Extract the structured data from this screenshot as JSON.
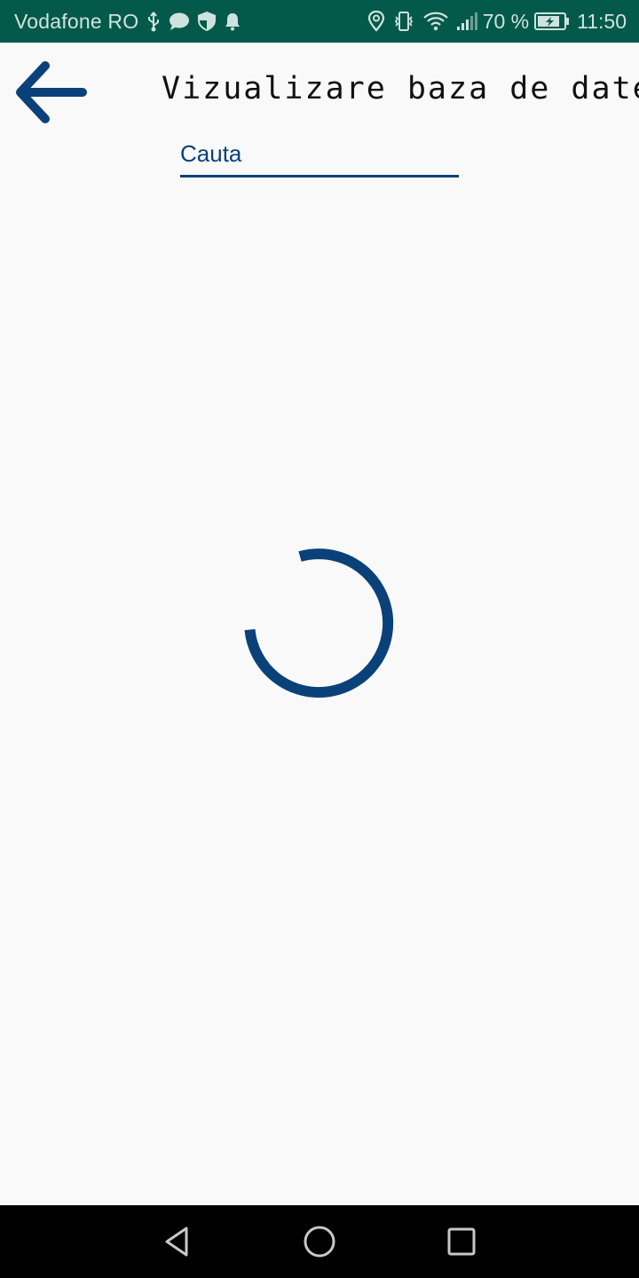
{
  "status_bar": {
    "carrier": "Vodafone RO",
    "battery": "70 %",
    "time": "11:50",
    "background_color": "#045a4a",
    "left_icons": [
      "usb-icon",
      "chat-bubble-icon",
      "shield-icon",
      "bell-icon"
    ],
    "right_icons": [
      "location-icon",
      "vibrate-icon",
      "wifi-icon",
      "signal-icon",
      "battery-charging-icon"
    ]
  },
  "header": {
    "title": "Vizualizare baza de date",
    "back_icon": "arrow-back-icon"
  },
  "search": {
    "placeholder": "Cauta",
    "value": ""
  },
  "loading": {
    "indicator": "progress-spinner"
  },
  "nav_bar": {
    "buttons": [
      "back-triangle-icon",
      "home-circle-icon",
      "recents-square-icon"
    ]
  },
  "colors": {
    "accent": "#0a4178",
    "background": "#f9f9f9",
    "nav_background": "#000000"
  }
}
